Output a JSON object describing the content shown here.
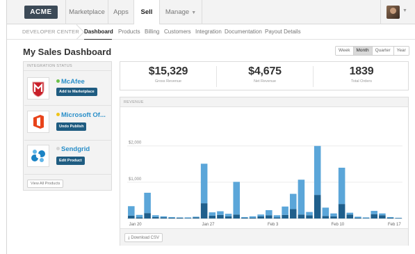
{
  "app": {
    "logo": "ACME"
  },
  "topnav": {
    "items": [
      {
        "label": "Marketplace"
      },
      {
        "label": "Apps"
      },
      {
        "label": "Sell"
      },
      {
        "label": "Manage"
      }
    ],
    "active": "Sell"
  },
  "subnav": {
    "crumb": "DEVELOPER CENTER",
    "items": [
      {
        "label": "Dashboard"
      },
      {
        "label": "Products"
      },
      {
        "label": "Billing"
      },
      {
        "label": "Customers"
      },
      {
        "label": "Integration"
      },
      {
        "label": "Documentation"
      },
      {
        "label": "Payout Details"
      }
    ],
    "active": "Dashboard"
  },
  "page": {
    "title": "My Sales Dashboard"
  },
  "range": {
    "options": [
      "Week",
      "Month",
      "Quarter",
      "Year"
    ],
    "selected": "Month"
  },
  "integration": {
    "header": "INTEGRATION STATUS",
    "items": [
      {
        "name": "McAfee",
        "status_color": "#6cc04a",
        "action": "Add to Marketplace"
      },
      {
        "name": "Microsoft Of...",
        "status_color": "#f0c419",
        "action": "Undo Publish"
      },
      {
        "name": "Sendgrid",
        "status_color": "#d4d4d4",
        "action": "Edit Product"
      }
    ],
    "view_all": "View All Products"
  },
  "kpis": [
    {
      "value": "$15,329",
      "label": "Gross Revenue"
    },
    {
      "value": "$4,675",
      "label": "Net Revenue"
    },
    {
      "value": "1839",
      "label": "Total Orders"
    }
  ],
  "revenue": {
    "header": "REVENUE",
    "download": "Download CSV"
  },
  "colors": {
    "light": "#5ba6d9",
    "dark": "#1f5f8c",
    "accent": "#1f5c81"
  },
  "chart_data": {
    "type": "bar",
    "stacked": true,
    "y_ticks": [
      "$2,000",
      "$1,000"
    ],
    "x_ticks": [
      "Jan 20",
      "Jan 27",
      "Feb 3",
      "Feb 10",
      "Feb 17"
    ],
    "ylim": [
      0,
      2800
    ],
    "grid": true,
    "series": [
      {
        "values": [
          80,
          30,
          150,
          40,
          30,
          20,
          20,
          10,
          30,
          420,
          80,
          100,
          60,
          110,
          20,
          20,
          60,
          90,
          30,
          100,
          260,
          110,
          90,
          650,
          70,
          60,
          400,
          110,
          20,
          10,
          120,
          90,
          20,
          10
        ]
      },
      {
        "values": [
          260,
          70,
          560,
          50,
          30,
          20,
          10,
          20,
          20,
          1090,
          90,
          100,
          70,
          900,
          20,
          40,
          50,
          140,
          60,
          230,
          420,
          960,
          90,
          1350,
          230,
          80,
          1000,
          50,
          30,
          20,
          90,
          50,
          20,
          10
        ]
      }
    ]
  }
}
